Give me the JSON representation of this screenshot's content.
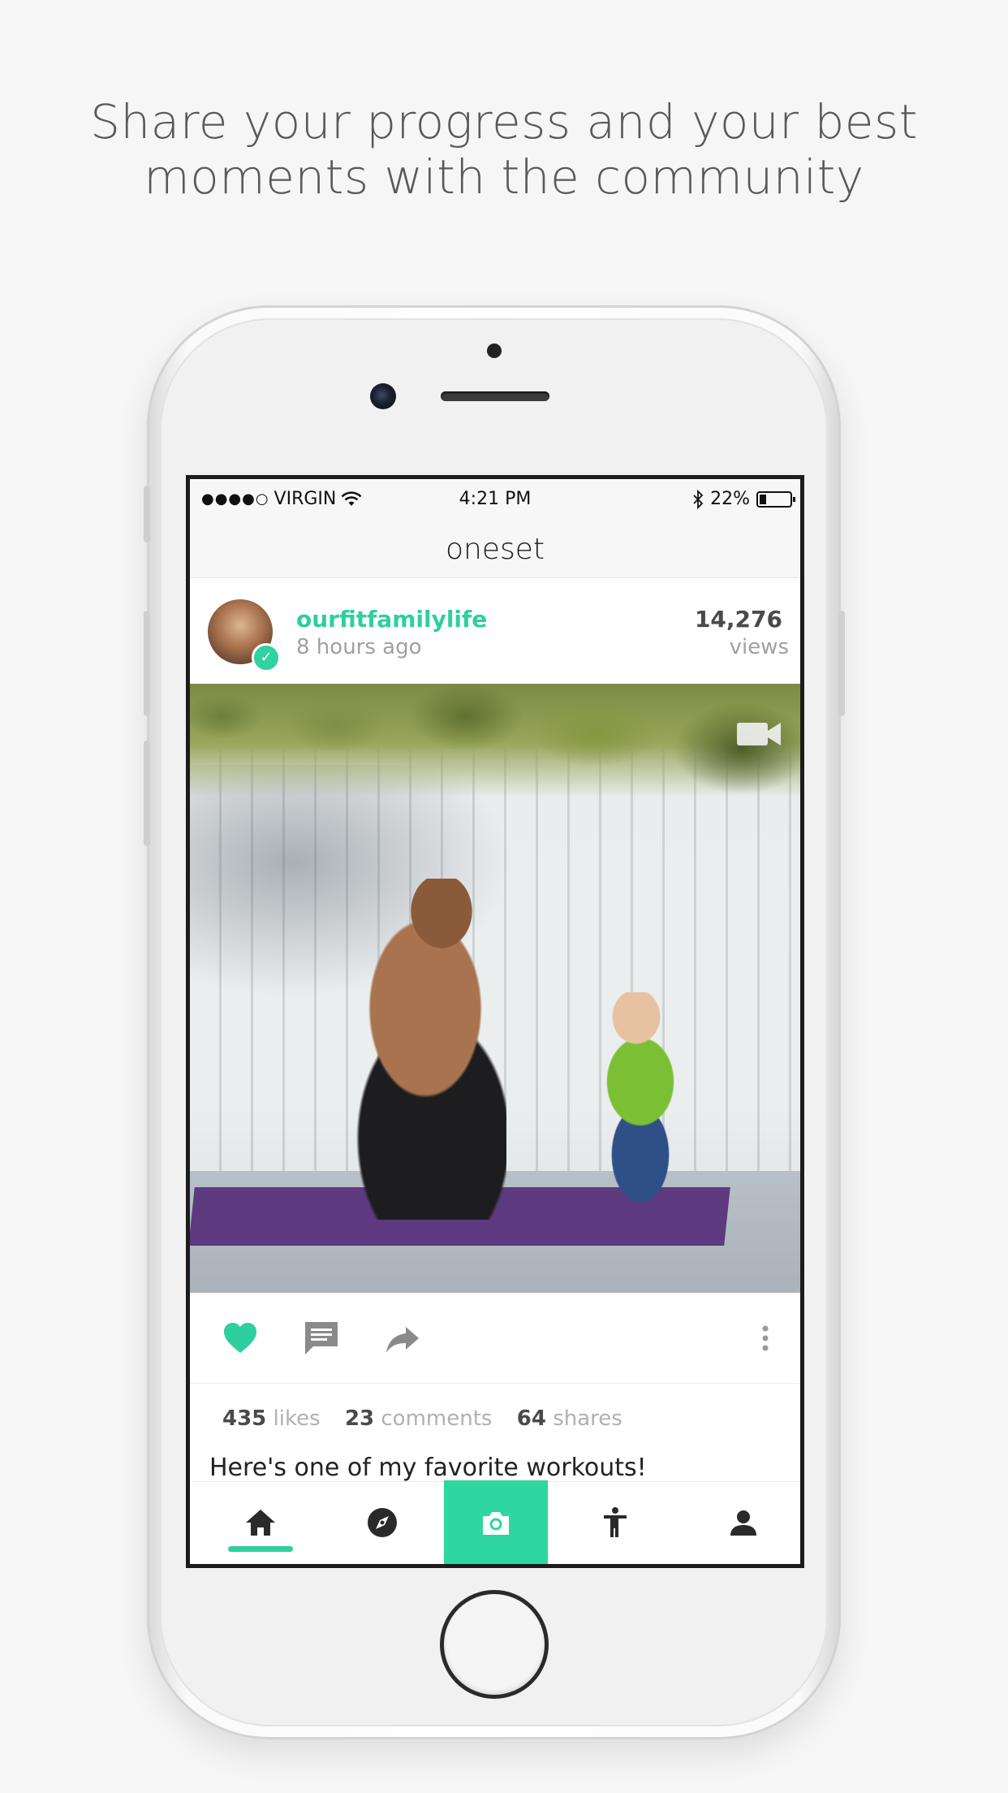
{
  "headline": {
    "line1": "Share your progress and your best",
    "line2": "moments with the community"
  },
  "status_bar": {
    "signal": "●●●●○",
    "carrier": "VIRGIN",
    "time": "4:21 PM",
    "battery": "22%",
    "battery_level": 0.22
  },
  "nav": {
    "title": "oneset"
  },
  "post": {
    "username": "ourfitfamilylife",
    "timestamp": "8 hours ago",
    "views_count": "14,276",
    "views_label": "views",
    "likes_count": "435",
    "likes_label": "likes",
    "comments_count": "23",
    "comments_label": "comments",
    "shares_count": "64",
    "shares_label": "shares",
    "caption": "Here's one of my favorite workouts!"
  },
  "colors": {
    "accent": "#2ecf9f",
    "camera_tab": "#2ed6a0",
    "text_dark": "#4a4a4a",
    "text_muted": "#a0a0a0"
  },
  "tabs": [
    {
      "name": "home",
      "icon": "home-icon",
      "active": true
    },
    {
      "name": "explore",
      "icon": "compass-icon"
    },
    {
      "name": "camera",
      "icon": "camera-icon"
    },
    {
      "name": "activity",
      "icon": "person-stretch-icon"
    },
    {
      "name": "profile",
      "icon": "profile-icon"
    }
  ]
}
